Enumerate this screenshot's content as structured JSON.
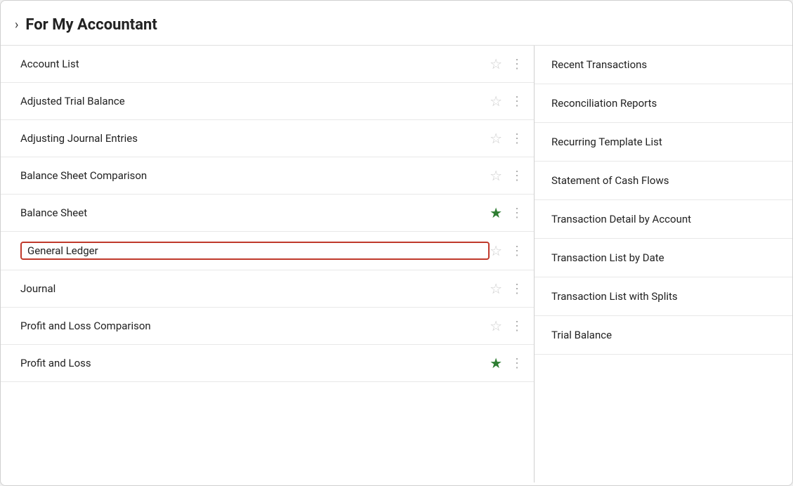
{
  "header": {
    "title": "For My Accountant",
    "chevron": "›"
  },
  "colors": {
    "star_filled": "#2e7d32",
    "star_empty": "#ccc",
    "highlight_border": "#c0392b"
  },
  "left_items": [
    {
      "id": "account-list",
      "label": "Account List",
      "star": "empty",
      "highlighted": false
    },
    {
      "id": "adjusted-trial-balance",
      "label": "Adjusted Trial Balance",
      "star": "empty",
      "highlighted": false
    },
    {
      "id": "adjusting-journal-entries",
      "label": "Adjusting Journal Entries",
      "star": "empty",
      "highlighted": false
    },
    {
      "id": "balance-sheet-comparison",
      "label": "Balance Sheet Comparison",
      "star": "empty",
      "highlighted": false
    },
    {
      "id": "balance-sheet",
      "label": "Balance Sheet",
      "star": "filled",
      "highlighted": false
    },
    {
      "id": "general-ledger",
      "label": "General Ledger",
      "star": "empty",
      "highlighted": true
    },
    {
      "id": "journal",
      "label": "Journal",
      "star": "empty",
      "highlighted": false
    },
    {
      "id": "profit-and-loss-comparison",
      "label": "Profit and Loss Comparison",
      "star": "empty",
      "highlighted": false
    },
    {
      "id": "profit-and-loss",
      "label": "Profit and Loss",
      "star": "filled",
      "highlighted": false
    }
  ],
  "right_items": [
    {
      "id": "recent-transactions",
      "label": "Recent Transactions"
    },
    {
      "id": "reconciliation-reports",
      "label": "Reconciliation Reports"
    },
    {
      "id": "recurring-template-list",
      "label": "Recurring Template List"
    },
    {
      "id": "statement-of-cash-flows",
      "label": "Statement of Cash Flows"
    },
    {
      "id": "transaction-detail-by-account",
      "label": "Transaction Detail by Account"
    },
    {
      "id": "transaction-list-by-date",
      "label": "Transaction List by Date"
    },
    {
      "id": "transaction-list-with-splits",
      "label": "Transaction List with Splits"
    },
    {
      "id": "trial-balance",
      "label": "Trial Balance"
    }
  ]
}
